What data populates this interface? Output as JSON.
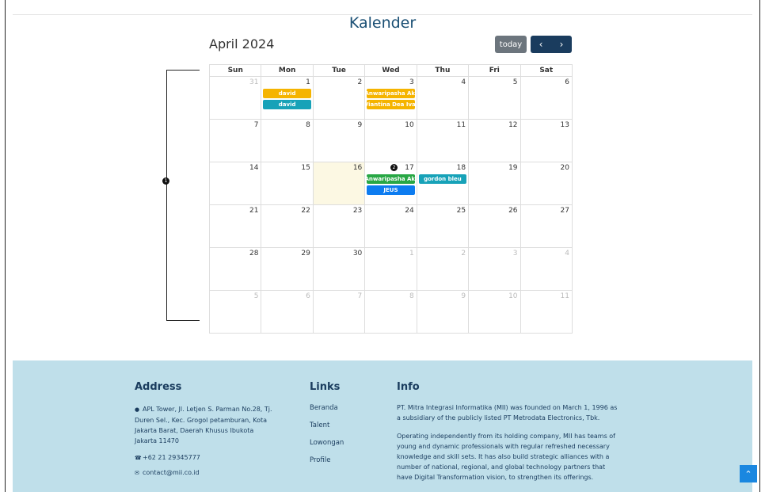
{
  "page": {
    "title": "Kalender"
  },
  "calendar": {
    "month_label": "April 2024",
    "today_label": "today",
    "prev_icon": "chevron-left-icon",
    "next_icon": "chevron-right-icon",
    "prev_glyph": "‹",
    "next_glyph": "›",
    "dow": [
      "Sun",
      "Mon",
      "Tue",
      "Wed",
      "Thu",
      "Fri",
      "Sat"
    ],
    "weeks": [
      [
        {
          "d": "31",
          "other": true,
          "events": []
        },
        {
          "d": "1",
          "events": [
            {
              "t": "david",
              "c": "#f5b400"
            },
            {
              "t": "david",
              "c": "#17a2b8"
            }
          ]
        },
        {
          "d": "2",
          "events": []
        },
        {
          "d": "3",
          "events": [
            {
              "t": "Anwaripasha Aki",
              "c": "#f5b400"
            },
            {
              "t": "Viantina Dea Ivai",
              "c": "#f5b400"
            }
          ]
        },
        {
          "d": "4",
          "events": []
        },
        {
          "d": "5",
          "events": []
        },
        {
          "d": "6",
          "events": []
        }
      ],
      [
        {
          "d": "7",
          "events": []
        },
        {
          "d": "8",
          "events": []
        },
        {
          "d": "9",
          "events": []
        },
        {
          "d": "10",
          "events": []
        },
        {
          "d": "11",
          "events": []
        },
        {
          "d": "12",
          "events": []
        },
        {
          "d": "13",
          "events": []
        }
      ],
      [
        {
          "d": "14",
          "events": []
        },
        {
          "d": "15",
          "events": []
        },
        {
          "d": "16",
          "today": true,
          "events": []
        },
        {
          "d": "17",
          "events": [
            {
              "t": "Anwaripasha Aki",
              "c": "#28a745"
            },
            {
              "t": "JEUS",
              "c": "#0d7cf0"
            }
          ]
        },
        {
          "d": "18",
          "events": [
            {
              "t": "gordon bleu",
              "c": "#17a2b8"
            }
          ]
        },
        {
          "d": "19",
          "events": []
        },
        {
          "d": "20",
          "events": []
        }
      ],
      [
        {
          "d": "21",
          "events": []
        },
        {
          "d": "22",
          "events": []
        },
        {
          "d": "23",
          "events": []
        },
        {
          "d": "24",
          "events": []
        },
        {
          "d": "25",
          "events": []
        },
        {
          "d": "26",
          "events": []
        },
        {
          "d": "27",
          "events": []
        }
      ],
      [
        {
          "d": "28",
          "events": []
        },
        {
          "d": "29",
          "events": []
        },
        {
          "d": "30",
          "events": []
        },
        {
          "d": "1",
          "other": true,
          "events": []
        },
        {
          "d": "2",
          "other": true,
          "events": []
        },
        {
          "d": "3",
          "other": true,
          "events": []
        },
        {
          "d": "4",
          "other": true,
          "events": []
        }
      ],
      [
        {
          "d": "5",
          "other": true,
          "events": []
        },
        {
          "d": "6",
          "other": true,
          "events": []
        },
        {
          "d": "7",
          "other": true,
          "events": []
        },
        {
          "d": "8",
          "other": true,
          "events": []
        },
        {
          "d": "9",
          "other": true,
          "events": []
        },
        {
          "d": "10",
          "other": true,
          "events": []
        },
        {
          "d": "11",
          "other": true,
          "events": []
        }
      ]
    ]
  },
  "annotations": {
    "marker1": "1",
    "marker2": "2"
  },
  "footer": {
    "address": {
      "heading": "Address",
      "lines": [
        "APL Tower, Jl. Letjen S. Parman No.28, Tj.",
        "Duren Sel., Kec. Grogol petamburan, Kota",
        "Jakarta Barat, Daerah Khusus Ibukota",
        "Jakarta 11470"
      ],
      "phone": "+62 21 29345777",
      "email": "contact@mii.co.id"
    },
    "links": {
      "heading": "Links",
      "items": [
        "Beranda",
        "Talent",
        "Lowongan",
        "Profile"
      ]
    },
    "info": {
      "heading": "Info",
      "p1": [
        "PT. Mitra Integrasi Informatika (MII) was founded on March 1, 1996 as",
        "a subsidiary of the publicly listed PT Metrodata Electronics, Tbk."
      ],
      "p2": [
        "Operating independently from its holding company, MII has teams of",
        "young and dynamic professionals with regular refreshed necessary",
        "knowledge and skill sets. It has also build strategic alliances with a",
        "number of national, regional, and global technology partners that",
        "have Digital Transformation vision, to strengthen its offerings."
      ]
    }
  },
  "scroll_top": {
    "icon": "chevron-up-icon",
    "glyph": "⌃"
  }
}
